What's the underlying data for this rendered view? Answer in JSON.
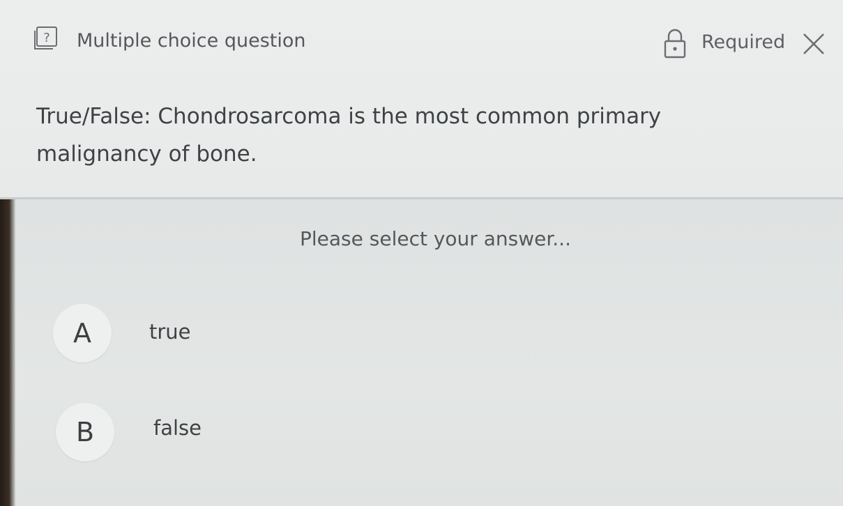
{
  "header": {
    "question_type": "Multiple choice question",
    "required_label": "Required",
    "question_icon": "question-mark-box-icon",
    "lock_icon": "lock-icon",
    "close_icon": "close-icon"
  },
  "question": {
    "text": "True/False: Chondrosarcoma is the most common primary malignancy of bone."
  },
  "answers": {
    "prompt": "Please select your answer...",
    "options": [
      {
        "letter": "A",
        "label": "true"
      },
      {
        "letter": "B",
        "label": "false"
      }
    ]
  },
  "colors": {
    "header_background": "#eceeee",
    "body_background": "#e0e3e2",
    "text": "#3f4245",
    "option_circle": "#eef0ef"
  }
}
